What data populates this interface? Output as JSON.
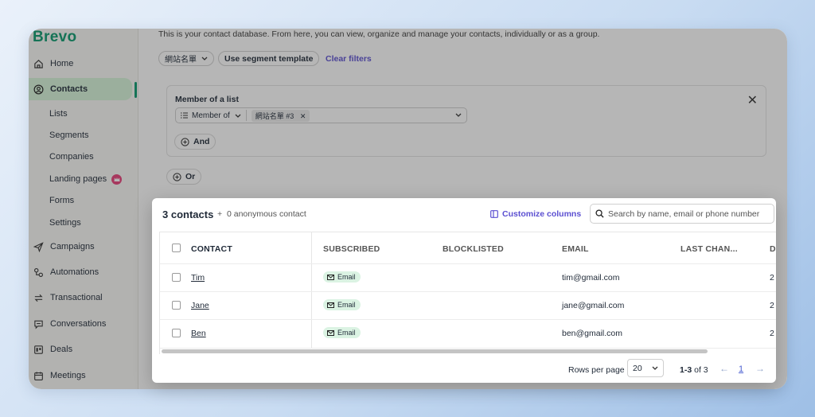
{
  "app": {
    "logo": "Brevo",
    "accent": "#0b996e"
  },
  "sidebar": {
    "items": [
      {
        "label": "Home",
        "icon": "home-icon"
      },
      {
        "label": "Contacts",
        "icon": "contacts-icon",
        "active": true
      },
      {
        "label": "Lists"
      },
      {
        "label": "Segments"
      },
      {
        "label": "Companies"
      },
      {
        "label": "Landing pages",
        "badge_icon": "crown-icon"
      },
      {
        "label": "Forms"
      },
      {
        "label": "Settings"
      },
      {
        "label": "Campaigns",
        "icon": "send-icon"
      },
      {
        "label": "Automations",
        "icon": "automation-icon"
      },
      {
        "label": "Transactional",
        "icon": "transactional-icon"
      },
      {
        "label": "Conversations",
        "icon": "chat-icon"
      },
      {
        "label": "Deals",
        "icon": "deals-icon"
      },
      {
        "label": "Meetings",
        "icon": "calendar-icon"
      }
    ]
  },
  "main": {
    "intro": "This is your contact database. From here, you can view, organize and manage your contacts, individually or as a group.",
    "list_dropdown": "網站名單",
    "segment_template": "Use segment template",
    "clear_filters": "Clear filters",
    "filter": {
      "title": "Member of a list",
      "condition": "Member of",
      "tag": "網站名單 #3",
      "and_label": "And",
      "or_label": "Or"
    }
  },
  "contacts_card": {
    "count": "3 contacts",
    "plus": "+",
    "anonymous": "0 anonymous contact",
    "customize": "Customize columns",
    "search_placeholder": "Search by name, email or phone number",
    "columns": [
      "CONTACT",
      "SUBSCRIBED",
      "BLOCKLISTED",
      "EMAIL",
      "LAST CHAN...",
      "D"
    ],
    "rows": [
      {
        "name": "Tim",
        "subscribed": "Email",
        "email": "tim@gmail.com",
        "extra": "2"
      },
      {
        "name": "Jane",
        "subscribed": "Email",
        "email": "jane@gmail.com",
        "extra": "2"
      },
      {
        "name": "Ben",
        "subscribed": "Email",
        "email": "ben@gmail.com",
        "extra": "2"
      }
    ],
    "footer": {
      "rows_per_page_label": "Rows per page",
      "rows_per_page": "20",
      "range_bold": "1-3",
      "range_rest": "of 3",
      "current_page": "1"
    }
  }
}
